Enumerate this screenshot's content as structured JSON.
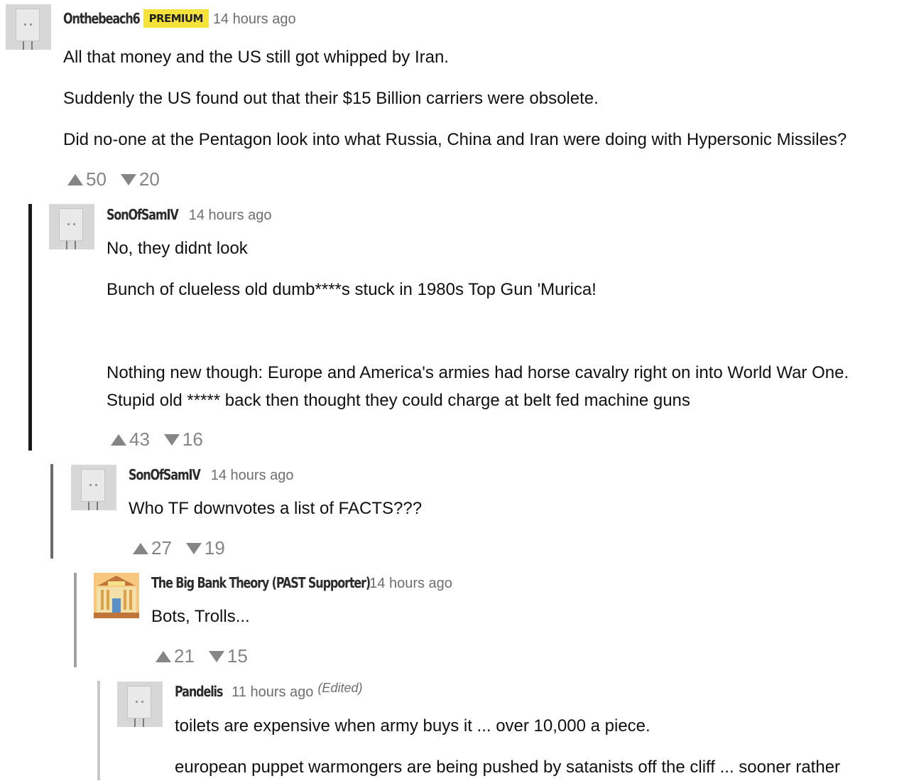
{
  "comments": [
    {
      "username": "Onthebeach6",
      "badge": "PREMIUM",
      "time": "14 hours ago",
      "paragraphs": [
        "All that money and the US still got whipped by Iran.",
        "Suddenly the US found out that their $15 Billion carriers were obsolete.",
        "Did no-one at the Pentagon look into what Russia, China and Iran were doing with Hypersonic Missiles?"
      ],
      "upvotes": "50",
      "downvotes": "20"
    },
    {
      "username": "SonOfSamIV",
      "time": "14 hours ago",
      "paragraphs": [
        "No, they didnt look",
        "Bunch of clueless old dumb****s stuck in 1980s Top Gun 'Murica!",
        "Nothing new though: Europe and America's armies had horse cavalry right on into World War One.",
        "Stupid old ***** back then thought they could charge at belt fed machine guns"
      ],
      "upvotes": "43",
      "downvotes": "16"
    },
    {
      "username": "SonOfSamIV",
      "time": "14 hours ago",
      "paragraphs": [
        "Who TF downvotes a list of FACTS???"
      ],
      "upvotes": "27",
      "downvotes": "19"
    },
    {
      "username": "The Big Bank Theory (PAST Supporter)",
      "time": "14 hours ago",
      "paragraphs": [
        "Bots, Trolls..."
      ],
      "upvotes": "21",
      "downvotes": "15"
    },
    {
      "username": "Pandelis",
      "time": "11 hours ago",
      "edited": "(Edited)",
      "paragraphs": [
        "toilets are expensive when army buys it ... over 10,000 a piece.",
        "european puppet warmongers are being pushed by satanists off the cliff ... sooner rather"
      ]
    }
  ],
  "colors": {
    "badge": "#f5e33b",
    "thread_line_1": "#1a1a1a",
    "thread_line_2": "#6b6b6b",
    "thread_line_3": "#a0a0a0",
    "thread_line_4": "#c8c8c8",
    "vote": "#858585"
  },
  "icons": [
    "upvote-arrow-icon",
    "downvote-arrow-icon",
    "default-avatar-icon",
    "bank-avatar-icon"
  ]
}
